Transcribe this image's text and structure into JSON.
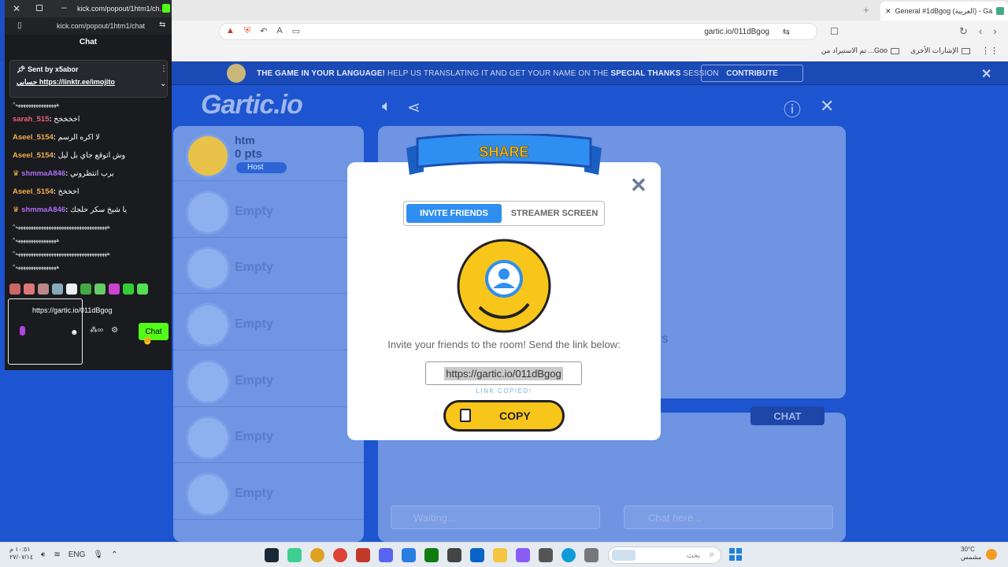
{
  "browser": {
    "tab_title": "General #1dBgog (العربية) - Ga",
    "url": "gartic.io/011dBgog",
    "bookmarks": [
      "الإشارات الأخرى",
      "تم الاستيراد من ...Goo"
    ]
  },
  "game": {
    "banner": {
      "part1": "THE GAME IN YOUR LANGUAGE!",
      "part2": "HELP US TRANSLATING IT AND GET YOUR NAME ON THE",
      "part3": "SPECIAL THANKS",
      "part4": "SESSION",
      "contribute_label": "CONTRIBUTE"
    },
    "logo": "Gartic.io",
    "players": {
      "host": {
        "name": "htm",
        "points": "0 pts",
        "badge": "Host"
      },
      "empty_label": "Empty"
    },
    "canvas_text": "rs",
    "chat_tab_label": "CHAT",
    "answer_placeholder": "Waiting...",
    "chat_placeholder": "Chat here..."
  },
  "modal": {
    "title": "SHARE",
    "tabs": {
      "invite": "INVITE FRIENDS",
      "streamer": "STREAMER SCREEN"
    },
    "invite_text": "Invite your friends to the room! Send the link below:",
    "link": "https://gartic.io/011dBgog",
    "copied_label": "LINK COPIED!",
    "copy_label": "COPY"
  },
  "kick": {
    "window_title": "kick.com/popout/1htm1/ch...",
    "url": "kick.com/popout/1htm1/chat",
    "panel_title": "Chat",
    "pinned": {
      "sent_by": "Sent by",
      "sender": "x5abor",
      "prefix": "حسابي",
      "link": "https://linktr.ee/imojito"
    },
    "messages": [
      {
        "user": "",
        "text": "^ههههههههههههههههه",
        "color": "#dddddd"
      },
      {
        "user": "sarah_515",
        "text": "اخخخخخ",
        "color": "#f0607a"
      },
      {
        "user": "Aseel_5154",
        "text": "لا اكره الرسم",
        "color": "#f3b04a"
      },
      {
        "user": "Aseel_5154",
        "text": "وش اتوقع جاي بل ليل",
        "color": "#f3b04a"
      },
      {
        "user": "shmmaA846",
        "text": "برب انتظروني",
        "color": "#b06cf0"
      },
      {
        "user": "Aseel_5154",
        "text": "اخخخخ",
        "color": "#f3b04a"
      },
      {
        "user": "shmmaA846",
        "text": "يا شيخ سكر حلجك",
        "color": "#b06cf0"
      }
    ],
    "dash_lines": [
      "^ههههههههههههههههههههههههههههههههههههه",
      "^ههههههههههههههههه",
      "^ههههههههههههههههههههههههههههههههههههه",
      "^ههههههههههههههههه"
    ],
    "input_value": "https://gartic.io/011dBgog",
    "send_label": "Chat"
  },
  "taskbar": {
    "time": "١٠:٥١ م",
    "date": "٢٧/٠٧/١٤",
    "lang": "ENG",
    "search_placeholder": "بحث",
    "temp": "30°C",
    "weather": "مشمس"
  }
}
